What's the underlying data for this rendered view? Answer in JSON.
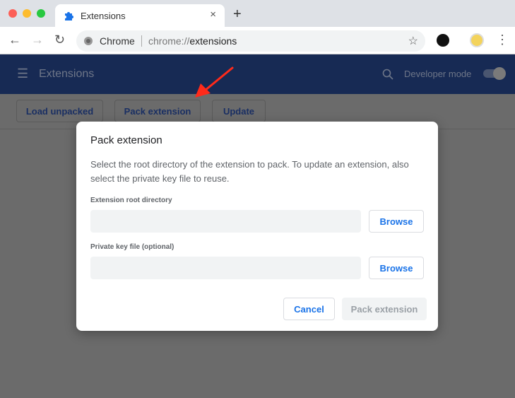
{
  "browser": {
    "tab_title": "Extensions",
    "omnibox_label": "Chrome",
    "url_prefix": "chrome://",
    "url_path": "extensions"
  },
  "header": {
    "title": "Extensions",
    "developer_mode_label": "Developer mode",
    "developer_mode_on": true
  },
  "toolbar": {
    "load_unpacked": "Load unpacked",
    "pack_extension": "Pack extension",
    "update": "Update"
  },
  "dialog": {
    "title": "Pack extension",
    "description": "Select the root directory of the extension to pack. To update an extension, also select the private key file to reuse.",
    "root_label": "Extension root directory",
    "root_value": "",
    "key_label": "Private key file (optional)",
    "key_value": "",
    "browse": "Browse",
    "cancel": "Cancel",
    "confirm": "Pack extension"
  },
  "colors": {
    "header": "#172a54",
    "accent": "#1a73e8",
    "annotation_arrow": "#ff2a1a"
  }
}
